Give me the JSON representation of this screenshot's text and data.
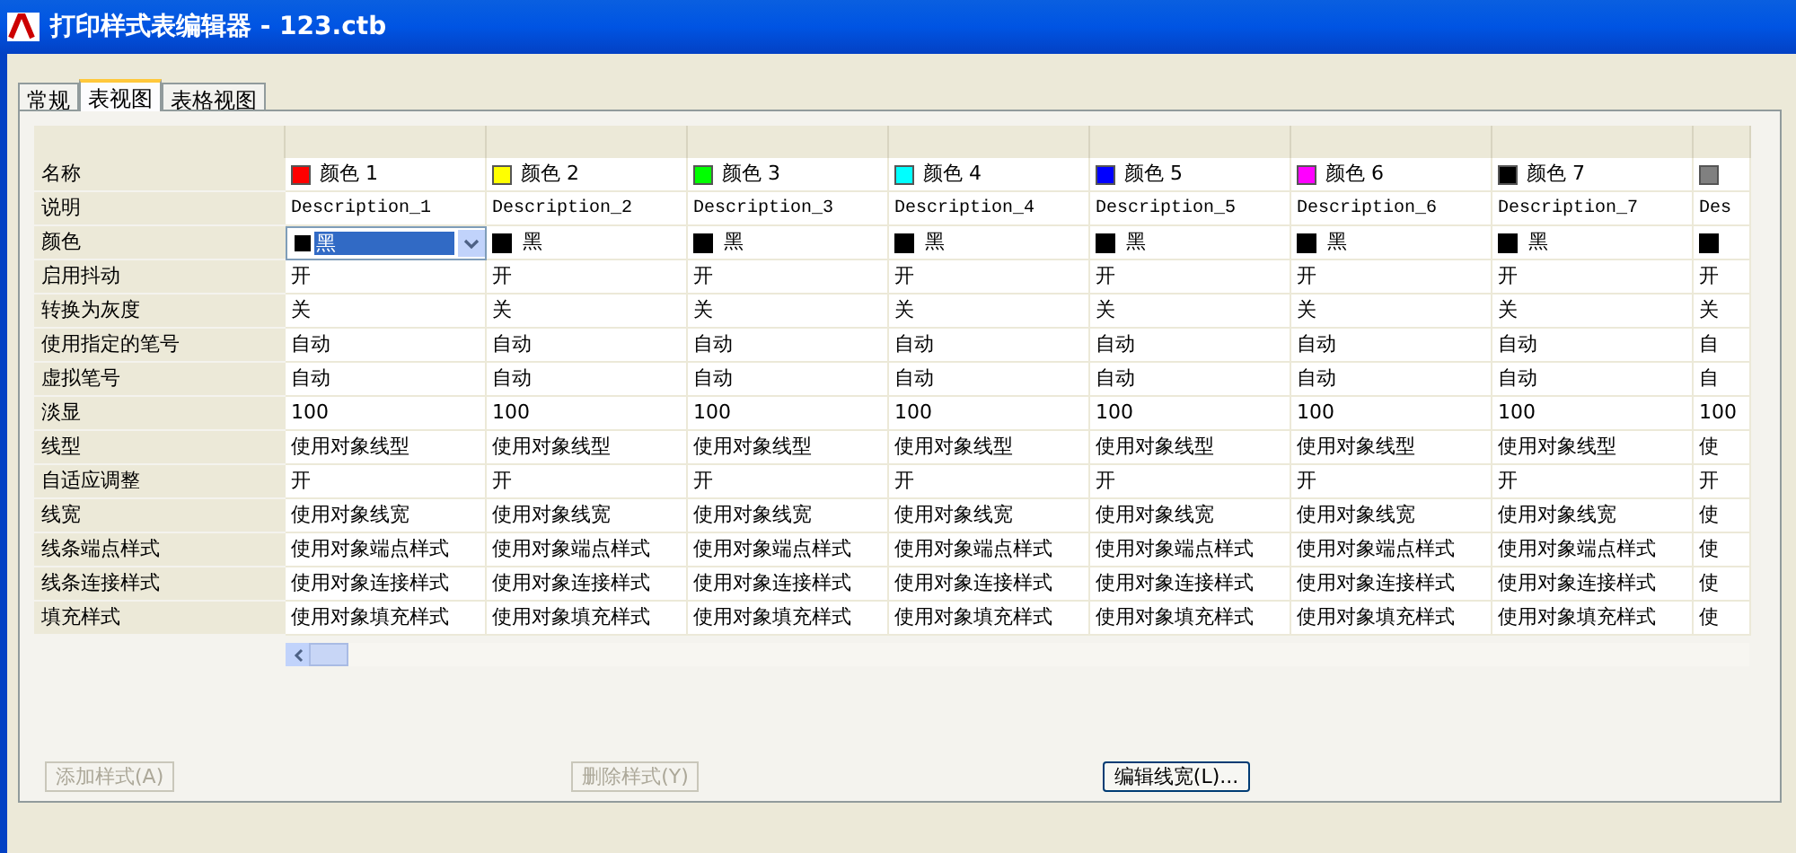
{
  "window": {
    "title": "打印样式表编辑器 - 123.ctb"
  },
  "tabs": [
    {
      "label": "常规",
      "selected": false
    },
    {
      "label": "表视图",
      "selected": true
    },
    {
      "label": "表格视图",
      "selected": false
    }
  ],
  "row_labels": [
    "名称",
    "说明",
    "颜色",
    "启用抖动",
    "转换为灰度",
    "使用指定的笔号",
    "虚拟笔号",
    "淡显",
    "线型",
    "自适应调整",
    "线宽",
    "线条端点样式",
    "线条连接样式",
    "填充样式"
  ],
  "columns": [
    {
      "name": "颜色 1",
      "color": "#ff0000",
      "description": "Description_1",
      "color_value": {
        "label": "黑",
        "color": "#000000",
        "selected": true
      },
      "cells": [
        "开",
        "关",
        "自动",
        "自动",
        "100",
        "使用对象线型",
        "开",
        "使用对象线宽",
        "使用对象端点样式",
        "使用对象连接样式",
        "使用对象填充样式"
      ]
    },
    {
      "name": "颜色 2",
      "color": "#ffff00",
      "description": "Description_2",
      "color_value": {
        "label": "黑",
        "color": "#000000",
        "selected": false
      },
      "cells": [
        "开",
        "关",
        "自动",
        "自动",
        "100",
        "使用对象线型",
        "开",
        "使用对象线宽",
        "使用对象端点样式",
        "使用对象连接样式",
        "使用对象填充样式"
      ]
    },
    {
      "name": "颜色 3",
      "color": "#00ff00",
      "description": "Description_3",
      "color_value": {
        "label": "黑",
        "color": "#000000",
        "selected": false
      },
      "cells": [
        "开",
        "关",
        "自动",
        "自动",
        "100",
        "使用对象线型",
        "开",
        "使用对象线宽",
        "使用对象端点样式",
        "使用对象连接样式",
        "使用对象填充样式"
      ]
    },
    {
      "name": "颜色 4",
      "color": "#00ffff",
      "description": "Description_4",
      "color_value": {
        "label": "黑",
        "color": "#000000",
        "selected": false
      },
      "cells": [
        "开",
        "关",
        "自动",
        "自动",
        "100",
        "使用对象线型",
        "开",
        "使用对象线宽",
        "使用对象端点样式",
        "使用对象连接样式",
        "使用对象填充样式"
      ]
    },
    {
      "name": "颜色 5",
      "color": "#0000ff",
      "description": "Description_5",
      "color_value": {
        "label": "黑",
        "color": "#000000",
        "selected": false
      },
      "cells": [
        "开",
        "关",
        "自动",
        "自动",
        "100",
        "使用对象线型",
        "开",
        "使用对象线宽",
        "使用对象端点样式",
        "使用对象连接样式",
        "使用对象填充样式"
      ]
    },
    {
      "name": "颜色 6",
      "color": "#ff00ff",
      "description": "Description_6",
      "color_value": {
        "label": "黑",
        "color": "#000000",
        "selected": false
      },
      "cells": [
        "开",
        "关",
        "自动",
        "自动",
        "100",
        "使用对象线型",
        "开",
        "使用对象线宽",
        "使用对象端点样式",
        "使用对象连接样式",
        "使用对象填充样式"
      ]
    },
    {
      "name": "颜色 7",
      "color": "#000000",
      "description": "Description_7",
      "color_value": {
        "label": "黑",
        "color": "#000000",
        "selected": false
      },
      "cells": [
        "开",
        "关",
        "自动",
        "自动",
        "100",
        "使用对象线型",
        "开",
        "使用对象线宽",
        "使用对象端点样式",
        "使用对象连接样式",
        "使用对象填充样式"
      ]
    },
    {
      "color": "#808080",
      "description": "Des",
      "color_value": {
        "color": "#000000",
        "selected": false
      },
      "cells": [
        "开",
        "关",
        "自",
        "自",
        "100",
        "使",
        "开",
        "使",
        "使",
        "使",
        "使"
      ]
    }
  ],
  "buttons": [
    {
      "label": "添加样式(A)",
      "disabled": true
    },
    {
      "label": "删除样式(Y)",
      "disabled": true
    },
    {
      "label": "编辑线宽(L)...",
      "disabled": false
    }
  ]
}
